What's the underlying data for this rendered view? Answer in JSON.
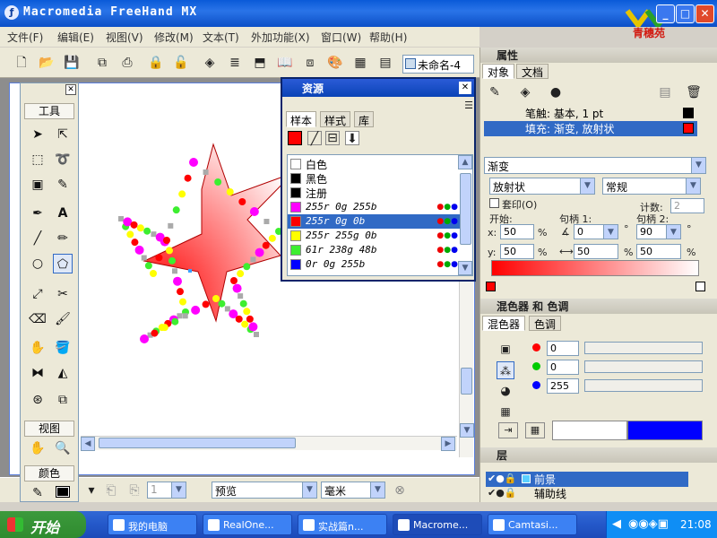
{
  "window": {
    "title": "Macromedia FreeHand MX",
    "logo_text": "青穗苑"
  },
  "menu": [
    "文件(F)",
    "编辑(E)",
    "视图(V)",
    "修改(M)",
    "文本(T)",
    "外加功能(X)",
    "窗口(W)",
    "帮助(H)"
  ],
  "toolbar": {
    "doc_name": "未命名-4"
  },
  "tools_panel": {
    "title": "工具",
    "view_label": "视图",
    "color_label": "颜色"
  },
  "status": {
    "preview": "预览",
    "unit": "毫米",
    "page": "1"
  },
  "assets": {
    "title": "资源",
    "tabs": [
      "样本",
      "样式",
      "库"
    ],
    "swatches": [
      {
        "name": "白色",
        "color": "#ffffff",
        "italic": false
      },
      {
        "name": "黑色",
        "color": "#000000",
        "italic": false
      },
      {
        "name": "注册",
        "color": "#000000",
        "italic": false
      },
      {
        "name": "255r 0g 255b",
        "color": "#ff00ff",
        "italic": true
      },
      {
        "name": "255r 0g 0b",
        "color": "#ff0000",
        "italic": true
      },
      {
        "name": "255r 255g 0b",
        "color": "#ffff00",
        "italic": true
      },
      {
        "name": "61r 238g 48b",
        "color": "#3dee30",
        "italic": true
      },
      {
        "name": "0r 0g 255b",
        "color": "#0000ff",
        "italic": true
      }
    ],
    "selected_index": 4
  },
  "properties": {
    "title": "属性",
    "tabs": [
      "对象",
      "文档"
    ],
    "rows": [
      {
        "label": "笔触: 基本, 1 pt",
        "color": "#000000",
        "selected": false
      },
      {
        "label": "填充: 渐变, 放射状",
        "color": "#ff0000",
        "selected": true
      }
    ],
    "fill_type": "渐变",
    "gradient_type": "放射状",
    "blend_mode": "常规",
    "overprint_label": "套印(O)",
    "count_label": "计数:",
    "count_value": "2",
    "start_label": "开始:",
    "handle1_label": "句柄 1:",
    "handle2_label": "句柄 2:",
    "x_label": "x:",
    "y_label": "y:",
    "x_value": "50",
    "y_value": "50",
    "handle1_angle": "0",
    "handle1_len": "50",
    "handle2_angle": "90",
    "handle2_len": "50",
    "percent": "%",
    "degree": "°"
  },
  "mixer": {
    "title": "混色器 和 色调",
    "tabs": [
      "混色器",
      "色调"
    ],
    "r": "0",
    "g": "0",
    "b": "255",
    "result_color": "#0000ff"
  },
  "layers": {
    "title": "层",
    "items": [
      {
        "name": "前景",
        "selected": true
      },
      {
        "name": "辅助线",
        "selected": false
      }
    ]
  },
  "taskbar": {
    "start": "开始",
    "tasks": [
      "我的电脑",
      "RealOne...",
      "实战篇n...",
      "Macrome...",
      "Camtasi..."
    ],
    "active_index": 3,
    "clock": "21:08"
  },
  "colors": {
    "accent": "#316ac5",
    "titlebar": "#0a5ad8",
    "dot_magenta": "#ff00ff",
    "dot_red": "#ff0000",
    "dot_yellow": "#ffff00",
    "dot_green": "#3dee30",
    "dot_gray": "#aaaaaa"
  }
}
